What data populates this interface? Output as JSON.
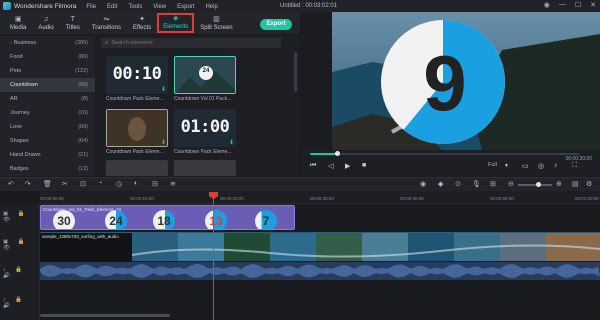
{
  "app": {
    "name": "Wondershare Filmora",
    "menu": [
      "File",
      "Edit",
      "Tools",
      "View",
      "Export",
      "Help"
    ],
    "document_title": "Untitled : 00:03:02:01"
  },
  "tool_tabs": [
    {
      "label": "Media",
      "icon": "folder-icon",
      "glyph": "▣"
    },
    {
      "label": "Audio",
      "icon": "music-note-icon",
      "glyph": "♫"
    },
    {
      "label": "Titles",
      "icon": "text-icon",
      "glyph": "T"
    },
    {
      "label": "Transitions",
      "icon": "transition-icon",
      "glyph": "⇋"
    },
    {
      "label": "Effects",
      "icon": "effects-icon",
      "glyph": "✦"
    },
    {
      "label": "Elements",
      "icon": "elements-icon",
      "glyph": "◈",
      "active": true
    },
    {
      "label": "Split Screen",
      "icon": "split-screen-icon",
      "glyph": "▥"
    }
  ],
  "export_label": "Export",
  "categories": [
    {
      "name": "Business",
      "count": "(389)",
      "expandable": true
    },
    {
      "name": "Food",
      "count": "(86)"
    },
    {
      "name": "Pets",
      "count": "(122)"
    },
    {
      "name": "Countdown",
      "count": "(68)",
      "selected": true
    },
    {
      "name": "AR",
      "count": "(8)"
    },
    {
      "name": "Journey",
      "count": "(16)"
    },
    {
      "name": "Love",
      "count": "(69)"
    },
    {
      "name": "Shapes",
      "count": "(64)"
    },
    {
      "name": "Hand Drawn",
      "count": "(21)"
    },
    {
      "name": "Badges",
      "count": "(12)"
    }
  ],
  "search_placeholder": "Search elements",
  "elements": [
    {
      "label": "Countdown Pack Eleme...",
      "display": "00:10"
    },
    {
      "label": "Countdown Vol 01 Pack...",
      "display": "24"
    },
    {
      "label": "Countdown Pack Eleme...",
      "display": ""
    },
    {
      "label": "Countdown Pack Eleme...",
      "display": "01:00"
    },
    {
      "label": "",
      "display": ""
    },
    {
      "label": "",
      "display": ""
    }
  ],
  "preview": {
    "countdown_number": "9",
    "progress_fraction": 0.1,
    "timecode": "00:00:20:20",
    "quality": "Full"
  },
  "timeline": {
    "ruler_labels": [
      "00:00:00:00",
      "00:00:10:00",
      "00:00:20:00",
      "00:00:30:00",
      "00:00:40:00",
      "00:00:50:00",
      "00:01:00:00"
    ],
    "element_clip_label": "Countdown_Vol_01_Pack_Element_18",
    "countdown_circles": [
      "30",
      "24",
      "18",
      "13",
      "7"
    ],
    "video_clip_label": "sample_1280x720_surfing_with_audio",
    "zoom_fraction": 0.6
  },
  "colors": {
    "accent": "#23c4a0",
    "highlight_red": "#e23a3a",
    "element_clip": "#6b5db6",
    "audio_clip": "#273b5c",
    "countdown_blue": "#1aa0e0"
  }
}
